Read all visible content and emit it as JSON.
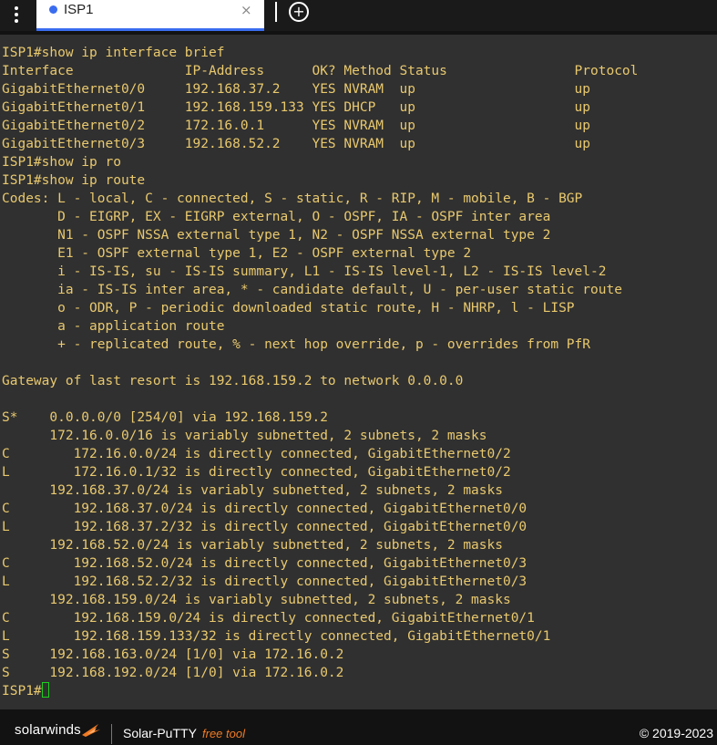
{
  "tabbar": {
    "tab_title": "ISP1",
    "close_glyph": "×",
    "add_glyph": "+",
    "tab_dot_color": "#3a6cf0"
  },
  "terminal": {
    "text_color": "#e9c96e",
    "cursor_color": "#1fd11f",
    "lines": [
      "ISP1#show ip interface brief",
      "Interface              IP-Address      OK? Method Status                Protocol",
      "GigabitEthernet0/0     192.168.37.2    YES NVRAM  up                    up",
      "GigabitEthernet0/1     192.168.159.133 YES DHCP   up                    up",
      "GigabitEthernet0/2     172.16.0.1      YES NVRAM  up                    up",
      "GigabitEthernet0/3     192.168.52.2    YES NVRAM  up                    up",
      "ISP1#show ip ro",
      "ISP1#show ip route",
      "Codes: L - local, C - connected, S - static, R - RIP, M - mobile, B - BGP",
      "       D - EIGRP, EX - EIGRP external, O - OSPF, IA - OSPF inter area",
      "       N1 - OSPF NSSA external type 1, N2 - OSPF NSSA external type 2",
      "       E1 - OSPF external type 1, E2 - OSPF external type 2",
      "       i - IS-IS, su - IS-IS summary, L1 - IS-IS level-1, L2 - IS-IS level-2",
      "       ia - IS-IS inter area, * - candidate default, U - per-user static route",
      "       o - ODR, P - periodic downloaded static route, H - NHRP, l - LISP",
      "       a - application route",
      "       + - replicated route, % - next hop override, p - overrides from PfR",
      "",
      "Gateway of last resort is 192.168.159.2 to network 0.0.0.0",
      "",
      "S*    0.0.0.0/0 [254/0] via 192.168.159.2",
      "      172.16.0.0/16 is variably subnetted, 2 subnets, 2 masks",
      "C        172.16.0.0/24 is directly connected, GigabitEthernet0/2",
      "L        172.16.0.1/32 is directly connected, GigabitEthernet0/2",
      "      192.168.37.0/24 is variably subnetted, 2 subnets, 2 masks",
      "C        192.168.37.0/24 is directly connected, GigabitEthernet0/0",
      "L        192.168.37.2/32 is directly connected, GigabitEthernet0/0",
      "      192.168.52.0/24 is variably subnetted, 2 subnets, 2 masks",
      "C        192.168.52.0/24 is directly connected, GigabitEthernet0/3",
      "L        192.168.52.2/32 is directly connected, GigabitEthernet0/3",
      "      192.168.159.0/24 is variably subnetted, 2 subnets, 2 masks",
      "C        192.168.159.0/24 is directly connected, GigabitEthernet0/1",
      "L        192.168.159.133/32 is directly connected, GigabitEthernet0/1",
      "S     192.168.163.0/24 [1/0] via 172.16.0.2",
      "S     192.168.192.0/24 [1/0] via 172.16.0.2"
    ],
    "prompt": "ISP1#"
  },
  "footer": {
    "brand": "solarwinds",
    "product": "Solar-PuTTY",
    "free_tag": "free tool",
    "copyright": "© 2019-2023",
    "accent_color": "#f07b24"
  }
}
